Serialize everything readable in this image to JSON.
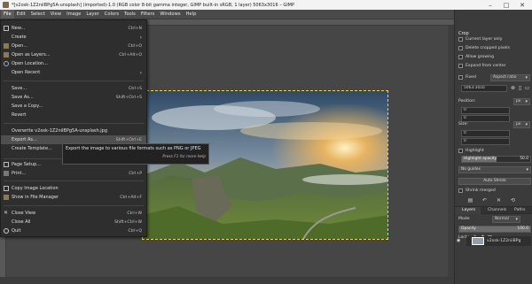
{
  "titlebar": {
    "title": "*[v2osk-1Z2niiBPg5A-unsplash] (imported)-1.0 (RGB color 8-bit gamma integer, GIMP built-in sRGB, 1 layer) 5063x3016 – GIMP",
    "minimize": "–",
    "maximize": "□",
    "close": "✕"
  },
  "menubar": [
    "File",
    "Edit",
    "Select",
    "View",
    "Image",
    "Layer",
    "Colors",
    "Tools",
    "Filters",
    "Windows",
    "Help"
  ],
  "file_menu": {
    "items": [
      {
        "label": "New...",
        "accel": "Ctrl+N"
      },
      {
        "label": "Create",
        "accel": "",
        "submenu": "›"
      },
      {
        "label": "Open...",
        "accel": "Ctrl+O"
      },
      {
        "label": "Open as Layers...",
        "accel": "Ctrl+Alt+O"
      },
      {
        "label": "Open Location...",
        "accel": ""
      },
      {
        "label": "Open Recent",
        "accel": "",
        "submenu": "›"
      },
      {
        "label": "Save...",
        "accel": "Ctrl+S"
      },
      {
        "label": "Save As...",
        "accel": "Shift+Ctrl+S"
      },
      {
        "label": "Save a Copy...",
        "accel": ""
      },
      {
        "label": "Revert",
        "accel": ""
      },
      {
        "label": "Overwrite v2osk-1Z2niiBPg5A-unsplash.jpg",
        "accel": ""
      },
      {
        "label": "Export As...",
        "accel": "Shift+Ctrl+E"
      },
      {
        "label": "Create Template...",
        "accel": ""
      },
      {
        "label": "Page Setup...",
        "accel": ""
      },
      {
        "label": "Print...",
        "accel": "Ctrl+P"
      },
      {
        "label": "Copy Image Location",
        "accel": ""
      },
      {
        "label": "Show in File Manager",
        "accel": "Ctrl+Alt+F"
      },
      {
        "label": "Close View",
        "accel": "Ctrl+W"
      },
      {
        "label": "Close All",
        "accel": "Shift+Ctrl+W"
      },
      {
        "label": "Quit",
        "accel": "Ctrl+Q"
      }
    ]
  },
  "tooltip": {
    "text": "Export the image to various file formats such as PNG or JPEG",
    "hint": "Press F1 for more help"
  },
  "right_dock": {
    "tool_title": "Crop",
    "options": [
      {
        "label": "Current layer only"
      },
      {
        "label": "Delete cropped pixels"
      },
      {
        "label": "Allow growing"
      },
      {
        "label": "Expand from center"
      }
    ],
    "fixed_label": "Fixed",
    "fixed_combo": "Aspect ratio",
    "ratio_value": "5063:3016",
    "position_label": "Position:",
    "position_unit": "px",
    "position_x": "0",
    "position_y": "0",
    "size_label": "Size:",
    "size_unit": "px",
    "size_w": "0",
    "size_h": "0",
    "highlight_label": "Highlight",
    "highlight_opacity_label": "Highlight opacity",
    "highlight_opacity_value": "50.0",
    "highlight_opacity_fraction": 0.5,
    "guides_combo": "No guides",
    "auto_shrink": "Auto Shrink",
    "shrink_merged": "Shrink merged",
    "tabs": [
      "Layers",
      "Channels",
      "Paths"
    ],
    "mode_label": "Mode",
    "mode_value": "Normal",
    "opacity_label": "Opacity",
    "opacity_value": "100.0",
    "opacity_fraction": 1.0,
    "lock_label": "Lock:",
    "layer_name": "v2osk-1Z2niiBPg"
  },
  "colors": {
    "selection_border": "#f0d84a",
    "menu_bg": "#2e2e2e",
    "dock_bg": "#3b3b3b"
  }
}
